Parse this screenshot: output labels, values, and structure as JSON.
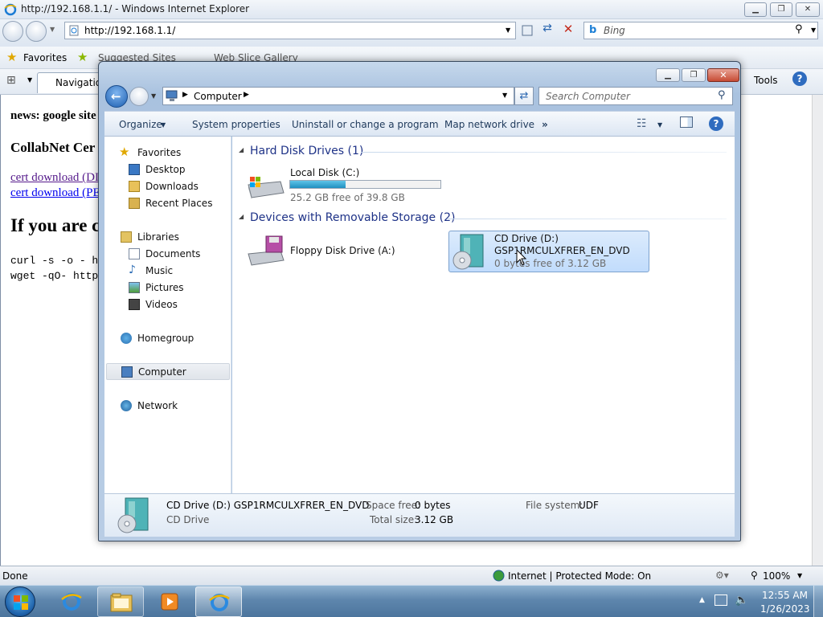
{
  "ie": {
    "title": "http://192.168.1.1/ - Windows Internet Explorer",
    "address": "http://192.168.1.1/",
    "search_placeholder": "Bing",
    "favorites_label": "Favorites",
    "suggested_sites": "Suggested Sites",
    "web_slice": "Web Slice Gallery",
    "tab_label": "Navigation",
    "tools_label": "Tools",
    "status_done": "Done",
    "status_zone": "Internet | Protected Mode: On",
    "zoom": "100%"
  },
  "webpage": {
    "news": "news: google site",
    "heading1": "CollabNet Cer",
    "link1": "cert download (DI",
    "link2": "cert download (PE",
    "heading2": "If you are c",
    "code1": "curl -s -o - h",
    "code2": "wget -qO- http"
  },
  "explorer": {
    "breadcrumb": "Computer",
    "search_placeholder": "Search Computer",
    "toolbar": {
      "organize": "Organize",
      "system_properties": "System properties",
      "uninstall": "Uninstall or change a program",
      "map_drive": "Map network drive",
      "more": "»"
    },
    "sidebar": {
      "favorites": "Favorites",
      "desktop": "Desktop",
      "downloads": "Downloads",
      "recent": "Recent Places",
      "libraries": "Libraries",
      "documents": "Documents",
      "music": "Music",
      "pictures": "Pictures",
      "videos": "Videos",
      "homegroup": "Homegroup",
      "computer": "Computer",
      "network": "Network"
    },
    "groups": {
      "hdd": "Hard Disk Drives (1)",
      "removable": "Devices with Removable Storage (2)"
    },
    "drives": {
      "c_name": "Local Disk (C:)",
      "c_free": "25.2 GB free of 39.8 GB",
      "c_used_fraction": 0.37,
      "floppy_name": "Floppy Disk Drive (A:)",
      "cd_name": "CD Drive (D:)",
      "cd_label": "GSP1RMCULXFRER_EN_DVD",
      "cd_free": "0 bytes free of 3.12 GB"
    },
    "details": {
      "title": "CD Drive (D:) GSP1RMCULXFRER_EN_DVD",
      "type": "CD Drive",
      "space_free_label": "Space free:",
      "space_free": "0 bytes",
      "total_size_label": "Total size:",
      "total_size": "3.12 GB",
      "fs_label": "File system:",
      "fs": "UDF"
    }
  },
  "taskbar": {
    "time": "12:55 AM",
    "date": "1/26/2023"
  },
  "colors": {
    "accent": "#1e3287",
    "selection": "#cce8ff",
    "taskbar": "#5e86ad"
  }
}
